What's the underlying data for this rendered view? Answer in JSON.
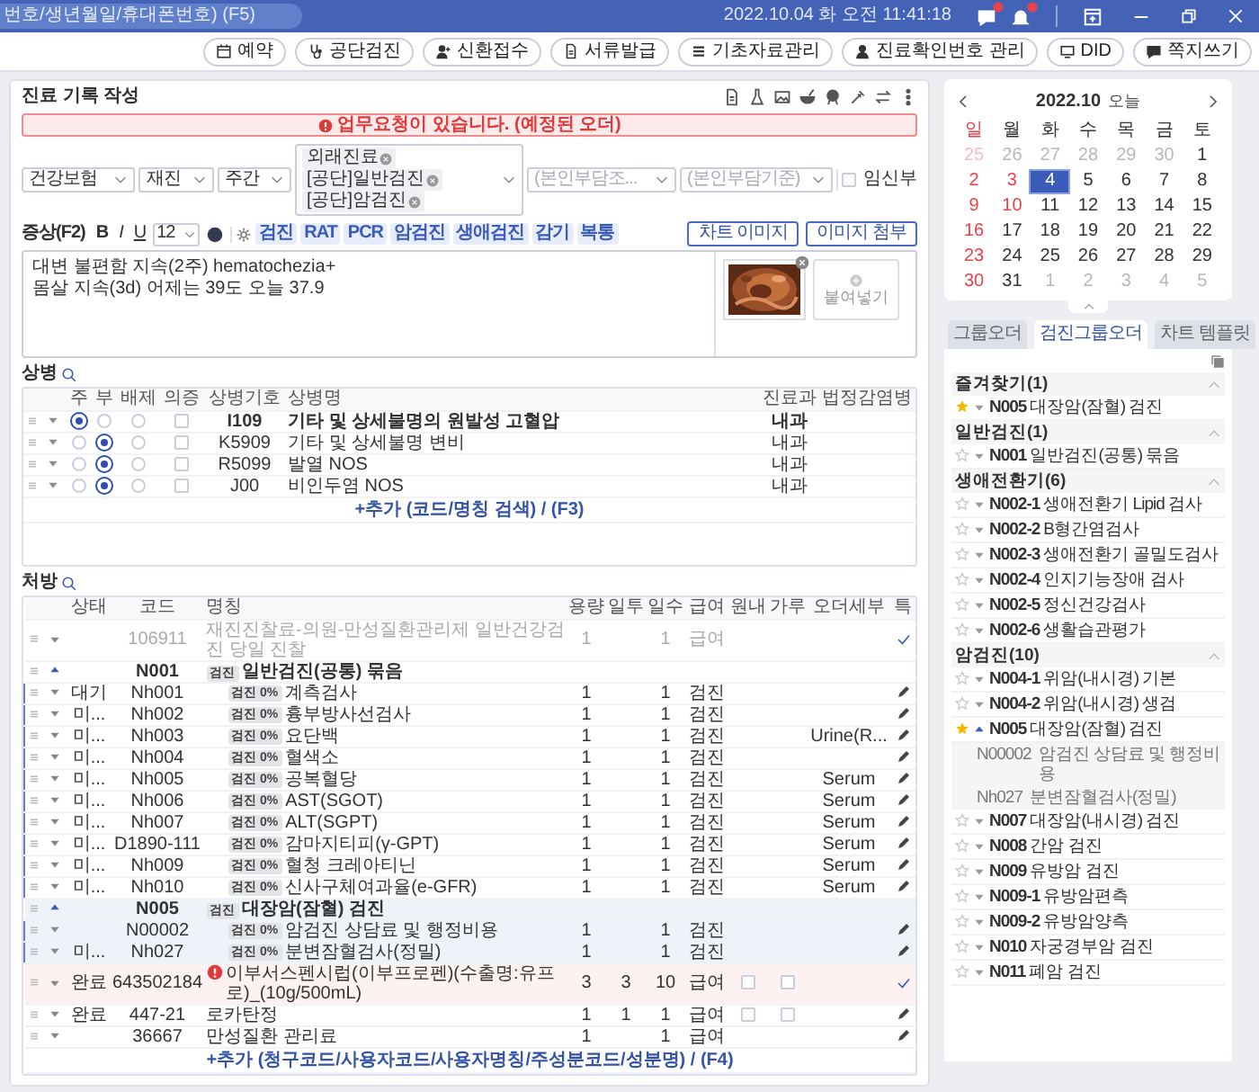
{
  "topbar": {
    "search_placeholder": "번호/생년월일/휴대폰번호) (F5)",
    "datetime": "2022.10.04 화 오전 11:41:18"
  },
  "actions": [
    "예약",
    "공단검진",
    "신환접수",
    "서류발급",
    "기초자료관리",
    "진료확인번호 관리",
    "DID",
    "쪽지쓰기"
  ],
  "record": {
    "title": "진료 기록 작성",
    "alert": "업무요청이 있습니다. (예정된 오더)",
    "selects": [
      {
        "value": "건강보험"
      },
      {
        "value": "재진"
      },
      {
        "value": "주간"
      },
      {
        "placeholder": "(본인부담조..."
      },
      {
        "placeholder": "(본인부담기준)"
      }
    ],
    "visit_tags": [
      "외래진료",
      "[공단]일반검진",
      "[공단]암검진"
    ],
    "pregnant": {
      "label": "임신부",
      "checked": false
    },
    "symptom_label": "증상(F2)",
    "format_buttons": [
      "B",
      "I",
      "U"
    ],
    "font_size": "12",
    "quick_tags": [
      "검진",
      "RAT",
      "PCR",
      "암검진",
      "생애검진",
      "감기",
      "복통"
    ],
    "image_buttons": [
      "차트 이미지",
      "이미지 첨부"
    ],
    "symptom_text": "대변 불편함 지속(2주) hematochezia+\n몸살 지속(3d) 어제는 39도 오늘 37.9",
    "paste_label": "붙여넣기"
  },
  "diagnosis": {
    "label": "상병",
    "columns": [
      "주",
      "부",
      "배제",
      "의증",
      "상병기호",
      "상병명",
      "진료과",
      "법정감염병"
    ],
    "rows": [
      {
        "main": true,
        "sub": false,
        "excluded": false,
        "suspected": false,
        "code": "I109",
        "name": "기타 및 상세불명의 원발성 고혈압",
        "dept": "내과"
      },
      {
        "main": false,
        "sub": true,
        "excluded": false,
        "suspected": false,
        "code": "K5909",
        "name": "기타 및 상세불명 변비",
        "dept": "내과"
      },
      {
        "main": false,
        "sub": true,
        "excluded": false,
        "suspected": false,
        "code": "R5099",
        "name": "발열 NOS",
        "dept": "내과"
      },
      {
        "main": false,
        "sub": true,
        "excluded": false,
        "suspected": false,
        "code": "J00",
        "name": "비인두염 NOS",
        "dept": "내과"
      }
    ],
    "add_link": "+추가 (코드/명칭 검색) / (F3)"
  },
  "prescription": {
    "label": "처방",
    "columns": [
      "상태",
      "코드",
      "명칭",
      "용량",
      "일투",
      "일수",
      "급여",
      "원내",
      "가루",
      "오더세부",
      "특"
    ],
    "rows": [
      {
        "kind": "order",
        "code": "106911",
        "name": "재진진찰료-의원-만성질환관리제 일반건강검진 당일 진찰",
        "dose": "1",
        "days": "1",
        "pay": "급여",
        "confirmed": true,
        "disabled": true,
        "warning": false,
        "selected": false
      },
      {
        "kind": "group",
        "code": "N001",
        "tag": "검진",
        "name": "일반검진(공통) 묶음",
        "expanded": true,
        "selected": false,
        "children": [
          {
            "kind": "order",
            "status": "대기",
            "code": "Nh001",
            "tag": "검진",
            "rate": "0%",
            "name": "계측검사",
            "dose": "1",
            "days": "1",
            "pay": "검진",
            "confirmed": false,
            "disabled": false,
            "warning": false,
            "selected": false
          },
          {
            "kind": "order",
            "status": "미...",
            "code": "Nh002",
            "tag": "검진",
            "rate": "0%",
            "name": "흉부방사선검사",
            "dose": "1",
            "days": "1",
            "pay": "검진",
            "confirmed": false,
            "disabled": false,
            "warning": false,
            "selected": false
          },
          {
            "kind": "order",
            "status": "미...",
            "code": "Nh003",
            "tag": "검진",
            "rate": "0%",
            "name": "요단백",
            "dose": "1",
            "days": "1",
            "pay": "검진",
            "detail": "Urine(R...",
            "confirmed": false,
            "disabled": false,
            "warning": false,
            "selected": false
          },
          {
            "kind": "order",
            "status": "미...",
            "code": "Nh004",
            "tag": "검진",
            "rate": "0%",
            "name": "혈색소",
            "dose": "1",
            "days": "1",
            "pay": "검진",
            "confirmed": false,
            "disabled": false,
            "warning": false,
            "selected": false
          },
          {
            "kind": "order",
            "status": "미...",
            "code": "Nh005",
            "tag": "검진",
            "rate": "0%",
            "name": "공복혈당",
            "dose": "1",
            "days": "1",
            "pay": "검진",
            "detail": "Serum",
            "confirmed": false,
            "disabled": false,
            "warning": false,
            "selected": false
          },
          {
            "kind": "order",
            "status": "미...",
            "code": "Nh006",
            "tag": "검진",
            "rate": "0%",
            "name": "AST(SGOT)",
            "dose": "1",
            "days": "1",
            "pay": "검진",
            "detail": "Serum",
            "confirmed": false,
            "disabled": false,
            "warning": false,
            "selected": false
          },
          {
            "kind": "order",
            "status": "미...",
            "code": "Nh007",
            "tag": "검진",
            "rate": "0%",
            "name": "ALT(SGPT)",
            "dose": "1",
            "days": "1",
            "pay": "검진",
            "detail": "Serum",
            "confirmed": false,
            "disabled": false,
            "warning": false,
            "selected": false
          },
          {
            "kind": "order",
            "status": "미...",
            "code": "D1890-111",
            "tag": "검진",
            "rate": "0%",
            "name": "감마지티피(γ-GPT)",
            "dose": "1",
            "days": "1",
            "pay": "검진",
            "detail": "Serum",
            "confirmed": false,
            "disabled": false,
            "warning": false,
            "selected": false
          },
          {
            "kind": "order",
            "status": "미...",
            "code": "Nh009",
            "tag": "검진",
            "rate": "0%",
            "name": "혈청 크레아티닌",
            "dose": "1",
            "days": "1",
            "pay": "검진",
            "detail": "Serum",
            "confirmed": false,
            "disabled": false,
            "warning": false,
            "selected": false
          },
          {
            "kind": "order",
            "status": "미...",
            "code": "Nh010",
            "tag": "검진",
            "rate": "0%",
            "name": "신사구체여과율(e-GFR)",
            "dose": "1",
            "days": "1",
            "pay": "검진",
            "detail": "Serum",
            "confirmed": false,
            "disabled": false,
            "warning": false,
            "selected": false
          }
        ]
      },
      {
        "kind": "group",
        "code": "N005",
        "tag": "검진",
        "name": "대장암(잠혈) 검진",
        "expanded": true,
        "selected": true,
        "children": [
          {
            "kind": "order",
            "code": "N00002",
            "tag": "검진",
            "rate": "0%",
            "name": "암검진 상담료 및 행정비용",
            "dose": "1",
            "days": "1",
            "pay": "검진",
            "confirmed": false,
            "disabled": false,
            "warning": false,
            "selected": true
          },
          {
            "kind": "order",
            "status": "미...",
            "code": "Nh027",
            "tag": "검진",
            "rate": "0%",
            "name": "분변잠혈검사(정밀)",
            "dose": "1",
            "days": "1",
            "pay": "검진",
            "confirmed": false,
            "disabled": false,
            "warning": false,
            "selected": true
          }
        ]
      },
      {
        "kind": "order",
        "status": "완료",
        "code": "643502184",
        "name": "이부서스펜시럽(이부프로펜)(수출명:유프로)_(10g/500mL)",
        "dose": "3",
        "daily": "3",
        "days": "10",
        "pay": "급여",
        "in_house": false,
        "powder": false,
        "confirmed": true,
        "disabled": false,
        "warning": true,
        "selected": false
      },
      {
        "kind": "order",
        "status": "완료",
        "code": "447-21",
        "name": "로카탄정",
        "dose": "1",
        "daily": "1",
        "days": "1",
        "pay": "급여",
        "in_house": false,
        "powder": false,
        "confirmed": false,
        "disabled": false,
        "warning": false,
        "selected": false
      },
      {
        "kind": "order",
        "code": "36667",
        "name": "만성질환 관리료",
        "dose": "1",
        "days": "1",
        "pay": "급여",
        "confirmed": false,
        "disabled": false,
        "warning": false,
        "selected": false
      }
    ],
    "add_link": "+추가 (청구코드/사용자코드/사용자명칭/주성분코드/성분명) / (F4)"
  },
  "calendar": {
    "title": "2022.10",
    "today_label": "오늘",
    "weekdays": [
      {
        "label": "일",
        "holiday": true
      },
      {
        "label": "월",
        "holiday": false
      },
      {
        "label": "화",
        "holiday": false
      },
      {
        "label": "수",
        "holiday": false
      },
      {
        "label": "목",
        "holiday": false
      },
      {
        "label": "금",
        "holiday": false
      },
      {
        "label": "토",
        "holiday": false
      }
    ],
    "weeks": [
      [
        {
          "day": "25",
          "muted": true,
          "holiday": true,
          "selected": false
        },
        {
          "day": "26",
          "muted": true,
          "holiday": false,
          "selected": false
        },
        {
          "day": "27",
          "muted": true,
          "holiday": false,
          "selected": false
        },
        {
          "day": "28",
          "muted": true,
          "holiday": false,
          "selected": false
        },
        {
          "day": "29",
          "muted": true,
          "holiday": false,
          "selected": false
        },
        {
          "day": "30",
          "muted": true,
          "holiday": false,
          "selected": false
        },
        {
          "day": "1",
          "muted": false,
          "holiday": false,
          "selected": false
        }
      ],
      [
        {
          "day": "2",
          "muted": false,
          "holiday": true,
          "selected": false
        },
        {
          "day": "3",
          "muted": false,
          "holiday": true,
          "selected": false
        },
        {
          "day": "4",
          "muted": false,
          "holiday": false,
          "selected": true
        },
        {
          "day": "5",
          "muted": false,
          "holiday": false,
          "selected": false
        },
        {
          "day": "6",
          "muted": false,
          "holiday": false,
          "selected": false
        },
        {
          "day": "7",
          "muted": false,
          "holiday": false,
          "selected": false
        },
        {
          "day": "8",
          "muted": false,
          "holiday": false,
          "selected": false
        }
      ],
      [
        {
          "day": "9",
          "muted": false,
          "holiday": true,
          "selected": false
        },
        {
          "day": "10",
          "muted": false,
          "holiday": true,
          "selected": false
        },
        {
          "day": "11",
          "muted": false,
          "holiday": false,
          "selected": false
        },
        {
          "day": "12",
          "muted": false,
          "holiday": false,
          "selected": false
        },
        {
          "day": "13",
          "muted": false,
          "holiday": false,
          "selected": false
        },
        {
          "day": "14",
          "muted": false,
          "holiday": false,
          "selected": false
        },
        {
          "day": "15",
          "muted": false,
          "holiday": false,
          "selected": false
        }
      ],
      [
        {
          "day": "16",
          "muted": false,
          "holiday": true,
          "selected": false
        },
        {
          "day": "17",
          "muted": false,
          "holiday": false,
          "selected": false
        },
        {
          "day": "18",
          "muted": false,
          "holiday": false,
          "selected": false
        },
        {
          "day": "19",
          "muted": false,
          "holiday": false,
          "selected": false
        },
        {
          "day": "20",
          "muted": false,
          "holiday": false,
          "selected": false
        },
        {
          "day": "21",
          "muted": false,
          "holiday": false,
          "selected": false
        },
        {
          "day": "22",
          "muted": false,
          "holiday": false,
          "selected": false
        }
      ],
      [
        {
          "day": "23",
          "muted": false,
          "holiday": true,
          "selected": false
        },
        {
          "day": "24",
          "muted": false,
          "holiday": false,
          "selected": false
        },
        {
          "day": "25",
          "muted": false,
          "holiday": false,
          "selected": false
        },
        {
          "day": "26",
          "muted": false,
          "holiday": false,
          "selected": false
        },
        {
          "day": "27",
          "muted": false,
          "holiday": false,
          "selected": false
        },
        {
          "day": "28",
          "muted": false,
          "holiday": false,
          "selected": false
        },
        {
          "day": "29",
          "muted": false,
          "holiday": false,
          "selected": false
        }
      ],
      [
        {
          "day": "30",
          "muted": false,
          "holiday": true,
          "selected": false
        },
        {
          "day": "31",
          "muted": false,
          "holiday": false,
          "selected": false
        },
        {
          "day": "1",
          "muted": true,
          "holiday": false,
          "selected": false
        },
        {
          "day": "2",
          "muted": true,
          "holiday": false,
          "selected": false
        },
        {
          "day": "3",
          "muted": true,
          "holiday": false,
          "selected": false
        },
        {
          "day": "4",
          "muted": true,
          "holiday": false,
          "selected": false
        },
        {
          "day": "5",
          "muted": true,
          "holiday": false,
          "selected": false
        }
      ]
    ]
  },
  "order_tabs": [
    {
      "label": "그룹오더",
      "selected": false
    },
    {
      "label": "검진그룹오더",
      "selected": true
    },
    {
      "label": "차트 템플릿",
      "selected": false
    }
  ],
  "order_groups": [
    {
      "title": "즐겨찾기(1)",
      "expanded": true,
      "items": [
        {
          "code": "N005",
          "name": "대장암(잠혈) 검진",
          "starred": true,
          "expanded": false
        }
      ]
    },
    {
      "title": "일반검진(1)",
      "expanded": true,
      "items": [
        {
          "code": "N001",
          "name": "일반검진(공통) 묶음",
          "starred": false,
          "expanded": false
        }
      ]
    },
    {
      "title": "생애전환기(6)",
      "expanded": true,
      "items": [
        {
          "code": "N002-1",
          "name": "생애전환기 Lipid 검사",
          "starred": false,
          "expanded": false
        },
        {
          "code": "N002-2",
          "name": "B형간염검사",
          "starred": false,
          "expanded": false
        },
        {
          "code": "N002-3",
          "name": "생애전환기 골밀도검사",
          "starred": false,
          "expanded": false
        },
        {
          "code": "N002-4",
          "name": "인지기능장애 검사",
          "starred": false,
          "expanded": false
        },
        {
          "code": "N002-5",
          "name": "정신건강검사",
          "starred": false,
          "expanded": false
        },
        {
          "code": "N002-6",
          "name": "생활습관평가",
          "starred": false,
          "expanded": false
        }
      ]
    },
    {
      "title": "암검진(10)",
      "expanded": true,
      "items": [
        {
          "code": "N004-1",
          "name": "위암(내시경) 기본",
          "starred": false,
          "expanded": false
        },
        {
          "code": "N004-2",
          "name": "위암(내시경) 생검",
          "starred": false,
          "expanded": false
        },
        {
          "code": "N005",
          "name": "대장암(잠혈) 검진",
          "starred": true,
          "expanded": true,
          "children": [
            {
              "code": "N00002",
              "name": "암검진 상담료 및 행정비용"
            },
            {
              "code": "Nh027",
              "name": "분변잠혈검사(정밀)"
            }
          ]
        },
        {
          "code": "N007",
          "name": "대장암(내시경) 검진",
          "starred": false,
          "expanded": false
        },
        {
          "code": "N008",
          "name": "간암 검진",
          "starred": false,
          "expanded": false
        },
        {
          "code": "N009",
          "name": "유방암 검진",
          "starred": false,
          "expanded": false
        },
        {
          "code": "N009-1",
          "name": "유방암편측",
          "starred": false,
          "expanded": false
        },
        {
          "code": "N009-2",
          "name": "유방암양측",
          "starred": false,
          "expanded": false
        },
        {
          "code": "N010",
          "name": "자궁경부암 검진",
          "starred": false,
          "expanded": false
        },
        {
          "code": "N011",
          "name": "폐암 검진",
          "starred": false,
          "expanded": false
        }
      ]
    }
  ]
}
